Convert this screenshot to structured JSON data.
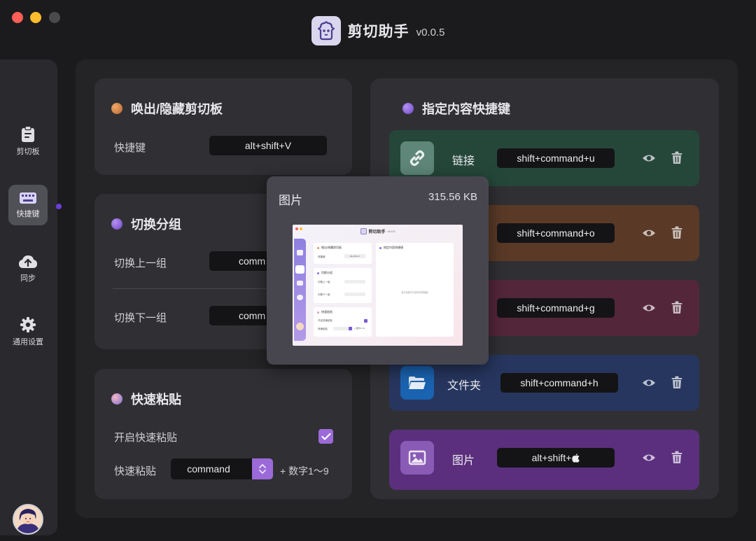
{
  "app": {
    "name": "剪切助手",
    "version": "v0.0.5"
  },
  "sidebar": {
    "items": [
      {
        "label": "剪切板",
        "icon": "clipboard-icon"
      },
      {
        "label": "快捷键",
        "icon": "keyboard-icon",
        "active": true
      },
      {
        "label": "同步",
        "icon": "cloud-upload-icon"
      },
      {
        "label": "通用设置",
        "icon": "gear-icon"
      }
    ]
  },
  "cards": {
    "toggle": {
      "title": "唤出/隐藏剪切板",
      "shortcut_label": "快捷键",
      "shortcut": "alt+shift+V"
    },
    "group": {
      "title": "切换分组",
      "prev_label": "切换上一组",
      "prev_shortcut": "comm",
      "next_label": "切换下一组",
      "next_shortcut": "comm"
    },
    "paste": {
      "title": "快速粘贴",
      "enable_label": "开启快速粘贴",
      "enabled": true,
      "paste_label": "快速粘贴",
      "modifier": "command",
      "suffix": "+ 数字1～9"
    },
    "content": {
      "title": "指定内容快捷键",
      "rows": [
        {
          "name": "链接",
          "shortcut": "shift+command+u",
          "icon": "link-icon",
          "color": "#25473a"
        },
        {
          "name": "",
          "shortcut": "shift+command+o",
          "icon": "",
          "color": "#5a3a27"
        },
        {
          "name": "",
          "shortcut": "shift+command+g",
          "icon": "",
          "color": "#54263a"
        },
        {
          "name": "文件夹",
          "shortcut": "shift+command+h",
          "icon": "folder-icon",
          "color": "#27365f"
        },
        {
          "name": "图片",
          "shortcut": "alt+shift+",
          "icon": "image-icon",
          "color": "#5b2f7d"
        }
      ]
    }
  },
  "popup": {
    "title": "图片",
    "size": "315.56 KB"
  },
  "preview": {
    "app_name": "剪切助手",
    "version": "v0.0.5",
    "card1_title": "唤出/隐藏剪切板",
    "card1_label": "快捷键",
    "card1_kbd": "alt+shift+V",
    "card2_title": "切换分组",
    "card2_label1": "切换上一组",
    "card2_label2": "切换下一组",
    "card3_title": "快速粘贴",
    "card3_label1": "开启快速粘贴",
    "card3_label2": "快速粘贴",
    "card3_suffix": "+ 数字1～9",
    "right_title": "指定内容快捷键",
    "right_empty": "暂无设置与内容剪切快捷键"
  }
}
